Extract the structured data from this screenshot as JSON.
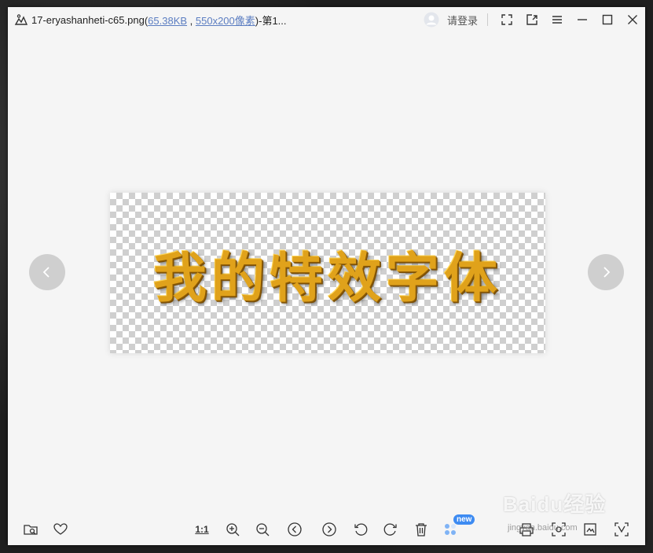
{
  "window": {
    "filename": "17-eryashanheti-c65.png",
    "paren_open": " (",
    "file_size": "65.38KB",
    "meta_sep": " , ",
    "dimensions": "550x200像素",
    "paren_close": ")",
    "page_info": " -第1..."
  },
  "header": {
    "login_label": "请登录"
  },
  "image": {
    "text": "我的特效字体"
  },
  "toolbar": {
    "ratio_label": "1:1",
    "new_badge": "new"
  },
  "watermark": {
    "brand": "Baidu经验",
    "url": "jingyan.baidu.com"
  },
  "colors": {
    "accent": "#3d8bf2",
    "text_gold": "#e0a21b",
    "window_bg": "#f5f5f5"
  }
}
